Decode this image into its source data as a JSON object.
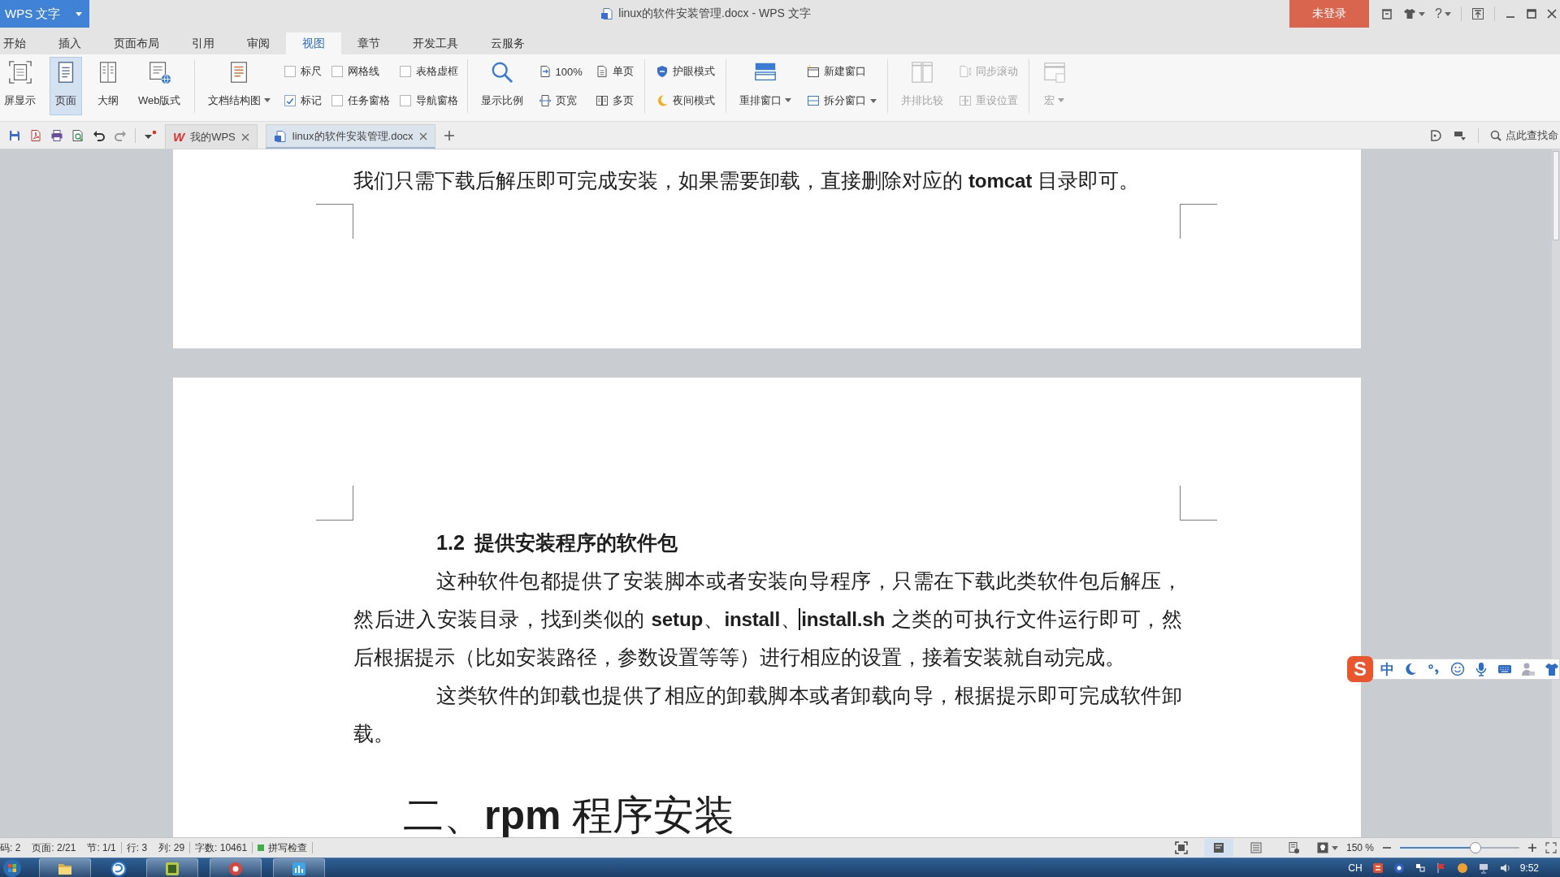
{
  "title_bar": {
    "app_button": "WPS 文字",
    "title": "linux的软件安装管理.docx - WPS 文字",
    "login_button": "未登录",
    "help_button": "?"
  },
  "menu_tabs": [
    {
      "label": "开始",
      "selected": false
    },
    {
      "label": "插入",
      "selected": false
    },
    {
      "label": "页面布局",
      "selected": false
    },
    {
      "label": "引用",
      "selected": false
    },
    {
      "label": "审阅",
      "selected": false
    },
    {
      "label": "视图",
      "selected": true
    },
    {
      "label": "章节",
      "selected": false
    },
    {
      "label": "开发工具",
      "selected": false
    },
    {
      "label": "云服务",
      "selected": false
    }
  ],
  "ribbon": {
    "groups": [
      {
        "disabled": false,
        "items": [
          {
            "kind": "large",
            "label": "屏显示",
            "selected": false
          },
          {
            "kind": "large",
            "label": "页面",
            "selected": true
          },
          {
            "kind": "large",
            "label": "大纲",
            "selected": false
          },
          {
            "kind": "large",
            "label": "Web版式",
            "selected": false
          }
        ]
      },
      {
        "disabled": false,
        "items": [
          {
            "kind": "large",
            "label": "文档结构图",
            "dropdown": true
          },
          {
            "kind": "stack",
            "items": [
              {
                "kind": "check",
                "label": "标尺",
                "checked": false
              },
              {
                "kind": "check",
                "label": "标记",
                "checked": true
              }
            ]
          },
          {
            "kind": "stack",
            "items": [
              {
                "kind": "check",
                "label": "网格线",
                "checked": false
              },
              {
                "kind": "check",
                "label": "任务窗格",
                "checked": false
              }
            ]
          },
          {
            "kind": "stack",
            "items": [
              {
                "kind": "check",
                "label": "表格虚框",
                "checked": false
              },
              {
                "kind": "check",
                "label": "导航窗格",
                "checked": false
              }
            ]
          }
        ]
      },
      {
        "disabled": false,
        "items": [
          {
            "kind": "large",
            "label": "显示比例"
          },
          {
            "kind": "stack",
            "items": [
              {
                "kind": "small",
                "label": "100%"
              },
              {
                "kind": "small",
                "label": "页宽"
              }
            ]
          },
          {
            "kind": "stack",
            "items": [
              {
                "kind": "small",
                "label": "单页"
              },
              {
                "kind": "small",
                "label": "多页"
              }
            ]
          }
        ]
      },
      {
        "disabled": false,
        "items": [
          {
            "kind": "stack",
            "items": [
              {
                "kind": "small",
                "label": "护眼模式"
              },
              {
                "kind": "small",
                "label": "夜间模式"
              }
            ]
          }
        ]
      },
      {
        "disabled": false,
        "items": [
          {
            "kind": "large",
            "label": "重排窗口",
            "dropdown": true
          },
          {
            "kind": "stack",
            "items": [
              {
                "kind": "small",
                "label": "新建窗口"
              },
              {
                "kind": "small",
                "label": "拆分窗口",
                "dropdown": true
              }
            ]
          }
        ]
      },
      {
        "disabled": true,
        "items": [
          {
            "kind": "large",
            "label": "并排比较"
          },
          {
            "kind": "stack",
            "items": [
              {
                "kind": "small",
                "label": "同步滚动"
              },
              {
                "kind": "small",
                "label": "重设位置"
              }
            ]
          }
        ]
      },
      {
        "disabled": true,
        "items": [
          {
            "kind": "large",
            "label": "宏",
            "dropdown": true
          }
        ]
      }
    ]
  },
  "document_tabs": [
    {
      "kind": "home",
      "logo": "W",
      "label": "我的WPS",
      "selected": false
    },
    {
      "kind": "document",
      "label": "linux的软件安装管理.docx",
      "selected": true
    }
  ],
  "command_search": {
    "placeholder": "点此查找命"
  },
  "document": {
    "pages": [
      {
        "kind": "tail",
        "blocks": [
          {
            "kind": "continued",
            "text": "我们只需下载后解压即可完成安装，如果需要卸载，直接删除对应的 **tomcat** 目录即可。"
          }
        ]
      },
      {
        "kind": "head",
        "blocks": [
          {
            "kind": "subheading",
            "number": "1.2",
            "title": "提供安装程序的软件包"
          },
          {
            "kind": "paragraph",
            "text": "这种软件包都提供了安装脚本或者安装向导程序，只需在下载此类软件包后解压，然后进入安装目录，找到类似的 **setup**、**install**、**install.sh** 之类的可执行文件运行即可，然后根据提示（比如安装路径，参数设置等等）进行相应的设置，接着安装就自动完成。"
          },
          {
            "kind": "paragraph",
            "text": "这类软件的卸载也提供了相应的卸载脚本或者卸载向导，根据提示即可完成软件卸载。"
          },
          {
            "kind": "heading",
            "text": "二、**rpm** 程序安装"
          }
        ]
      }
    ]
  },
  "ime_toolbar": {
    "logo": "S",
    "mode": "中"
  },
  "status_bar": {
    "groups": [
      [
        "码: 2",
        "页面: 2/21",
        "节: 1/1"
      ],
      [
        "行: 3",
        "列: 29"
      ],
      [
        "字数: 10461"
      ]
    ],
    "spell_check": "拼写检查",
    "view_buttons": [
      {
        "selected": false
      },
      {
        "selected": true
      },
      {
        "selected": false
      },
      {
        "selected": false
      }
    ],
    "zoom": "150 %",
    "zoom_slider": {
      "level": 0.63
    }
  },
  "taskbar": {
    "language": "CH",
    "clock": "9:52"
  }
}
